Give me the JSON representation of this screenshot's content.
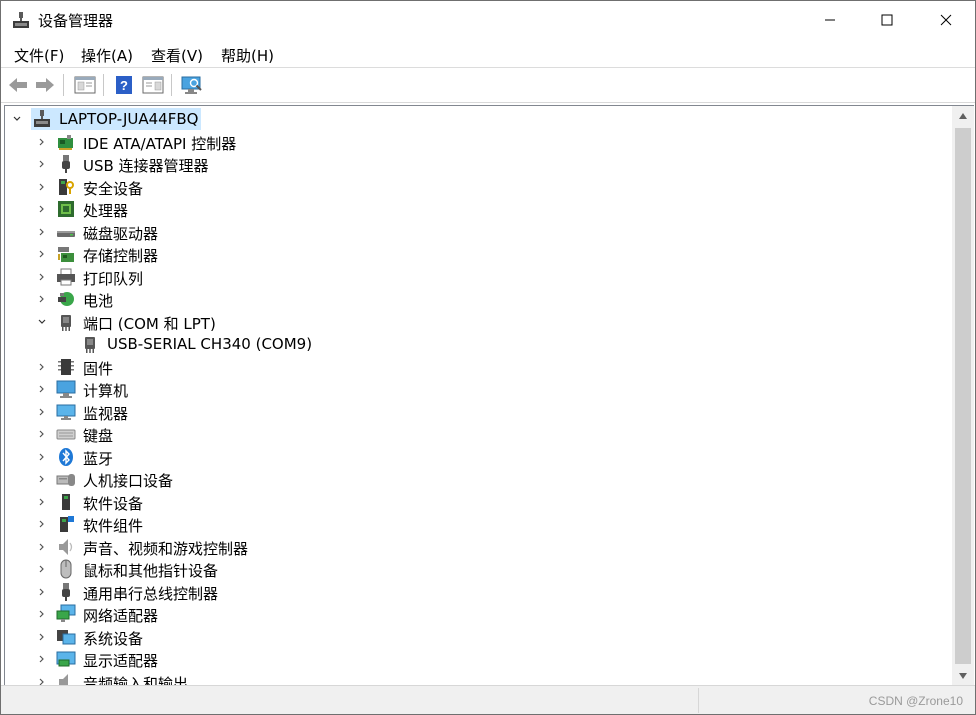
{
  "window": {
    "title": "设备管理器"
  },
  "menu": [
    {
      "label": "文件(F)"
    },
    {
      "label": "操作(A)"
    },
    {
      "label": "查看(V)"
    },
    {
      "label": "帮助(H)"
    }
  ],
  "tree": {
    "root": "LAPTOP-JUA44FBQ",
    "items": [
      {
        "label": "IDE ATA/ATAPI 控制器",
        "icon": "ide-controller-icon"
      },
      {
        "label": "USB 连接器管理器",
        "icon": "usb-connector-icon"
      },
      {
        "label": "安全设备",
        "icon": "security-device-icon"
      },
      {
        "label": "处理器",
        "icon": "processor-icon"
      },
      {
        "label": "磁盘驱动器",
        "icon": "disk-drive-icon"
      },
      {
        "label": "存储控制器",
        "icon": "storage-controller-icon"
      },
      {
        "label": "打印队列",
        "icon": "printer-icon"
      },
      {
        "label": "电池",
        "icon": "battery-icon"
      },
      {
        "label": "端口 (COM 和 LPT)",
        "icon": "port-icon",
        "expanded": true
      },
      {
        "label": "USB-SERIAL CH340 (COM9)",
        "icon": "port-icon",
        "child": true
      },
      {
        "label": "固件",
        "icon": "firmware-icon"
      },
      {
        "label": "计算机",
        "icon": "computer-icon"
      },
      {
        "label": "监视器",
        "icon": "monitor-icon"
      },
      {
        "label": "键盘",
        "icon": "keyboard-icon"
      },
      {
        "label": "蓝牙",
        "icon": "bluetooth-icon"
      },
      {
        "label": "人机接口设备",
        "icon": "hid-icon"
      },
      {
        "label": "软件设备",
        "icon": "software-device-icon"
      },
      {
        "label": "软件组件",
        "icon": "software-component-icon"
      },
      {
        "label": "声音、视频和游戏控制器",
        "icon": "speaker-icon"
      },
      {
        "label": "鼠标和其他指针设备",
        "icon": "mouse-icon"
      },
      {
        "label": "通用串行总线控制器",
        "icon": "usb-controller-icon"
      },
      {
        "label": "网络适配器",
        "icon": "network-adapter-icon"
      },
      {
        "label": "系统设备",
        "icon": "system-device-icon"
      },
      {
        "label": "显示适配器",
        "icon": "display-adapter-icon"
      },
      {
        "label": "音频输入和输出",
        "icon": "audio-io-icon"
      }
    ]
  },
  "watermark": "CSDN @Zrone10"
}
